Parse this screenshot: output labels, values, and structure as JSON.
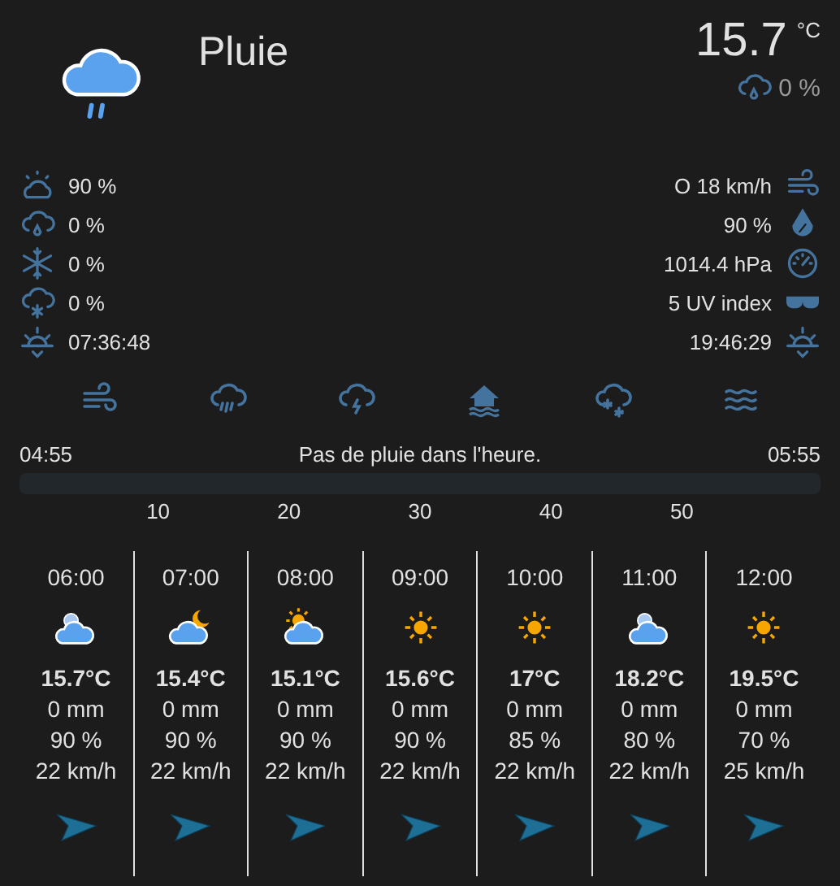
{
  "current": {
    "condition": "Pluie",
    "temperature": "15.7",
    "unit": "°C",
    "precipitation_probability": "0 %"
  },
  "left_stats": [
    {
      "kind": "cloud-cover",
      "value": "90 %"
    },
    {
      "kind": "rain-probability",
      "value": "0 %"
    },
    {
      "kind": "freeze-probability",
      "value": "0 %"
    },
    {
      "kind": "snow-probability",
      "value": "0 %"
    },
    {
      "kind": "sunrise",
      "value": "07:36:48"
    }
  ],
  "right_stats": [
    {
      "kind": "wind",
      "value": "O 18 km/h"
    },
    {
      "kind": "humidity",
      "value": "90 %"
    },
    {
      "kind": "pressure",
      "value": "1014.4 hPa"
    },
    {
      "kind": "uv",
      "value": "5 UV index"
    },
    {
      "kind": "sunset",
      "value": "19:46:29"
    }
  ],
  "rain_forecast": {
    "start": "04:55",
    "message": "Pas de pluie dans l'heure.",
    "end": "05:55",
    "ticks": [
      "10",
      "20",
      "30",
      "40",
      "50"
    ]
  },
  "hours": [
    {
      "time": "06:00",
      "kind": "cloudy",
      "temperature": "15.7°C",
      "precipitation": "0 mm",
      "humidity": "90 %",
      "wind": "22 km/h"
    },
    {
      "time": "07:00",
      "kind": "partly-night",
      "temperature": "15.4°C",
      "precipitation": "0 mm",
      "humidity": "90 %",
      "wind": "22 km/h"
    },
    {
      "time": "08:00",
      "kind": "partly-day",
      "temperature": "15.1°C",
      "precipitation": "0 mm",
      "humidity": "90 %",
      "wind": "22 km/h"
    },
    {
      "time": "09:00",
      "kind": "sunny",
      "temperature": "15.6°C",
      "precipitation": "0 mm",
      "humidity": "90 %",
      "wind": "22 km/h"
    },
    {
      "time": "10:00",
      "kind": "sunny",
      "temperature": "17°C",
      "precipitation": "0 mm",
      "humidity": "85 %",
      "wind": "22 km/h"
    },
    {
      "time": "11:00",
      "kind": "cloudy",
      "temperature": "18.2°C",
      "precipitation": "0 mm",
      "humidity": "80 %",
      "wind": "22 km/h"
    },
    {
      "time": "12:00",
      "kind": "sunny",
      "temperature": "19.5°C",
      "precipitation": "0 mm",
      "humidity": "70 %",
      "wind": "25 km/h"
    }
  ]
}
